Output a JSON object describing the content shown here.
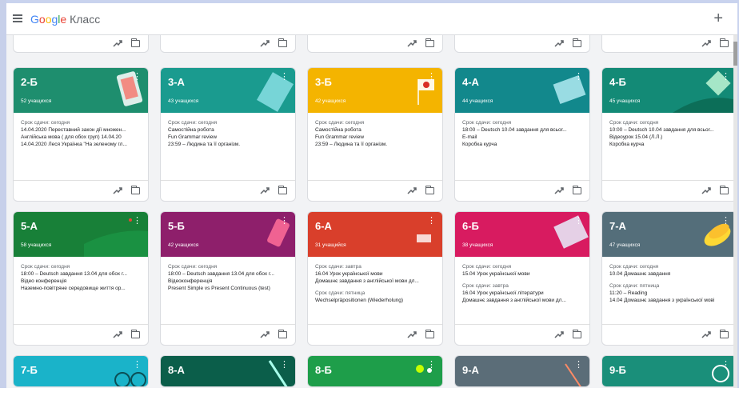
{
  "app": {
    "brand": "Google Класс"
  },
  "icons": {
    "menu": "hamburger-icon",
    "add": "plus-icon",
    "trend": "trending-up-icon",
    "folder": "folder-icon",
    "more": "more-vert-icon"
  },
  "cards": [
    {
      "name": "2-Б",
      "count": "52 учащихся",
      "color": "#1e8e6e",
      "due": "Срок сдачи: сегодня",
      "lines": [
        "14.04.2020 Переставний закон дії множен...",
        "Англійська мова ( для обох груп) 14.04.20",
        "14.04.2020 Леся Українка \"На зеленому гл..."
      ],
      "due2": "",
      "lines2": []
    },
    {
      "name": "3-А",
      "count": "43 учащихся",
      "color": "#1a9b8f",
      "due": "Срок сдачи: сегодня",
      "lines": [
        "Самостійна робота",
        "Fun Grammar review",
        "23:59 – Людина та її організм."
      ],
      "due2": "",
      "lines2": []
    },
    {
      "name": "3-Б",
      "count": "42 учащихся",
      "color": "#f4b400",
      "due": "Срок сдачи: сегодня",
      "lines": [
        "Самостійна робота",
        "Fun Grammar review",
        "23:59 – Людина та її організм."
      ],
      "due2": "",
      "lines2": []
    },
    {
      "name": "4-А",
      "count": "44 учащихся",
      "color": "#12888c",
      "due": "Срок сдачи: сегодня",
      "lines": [
        "18:00 – Deutsch 10.04 завдання для всьог...",
        "E-mail",
        "Коробка курча"
      ],
      "due2": "",
      "lines2": []
    },
    {
      "name": "4-Б",
      "count": "45 учащихся",
      "color": "#138a76",
      "due": "Срок сдачи: сегодня",
      "lines": [
        "10:00 – Deutsch 10.04 завдання для всьог...",
        "Відеоурок 15.04 (Л.Л.)",
        "Коробка курча"
      ],
      "due2": "",
      "lines2": []
    },
    {
      "name": "5-А",
      "count": "58 учащихся",
      "color": "#188038",
      "due": "Срок сдачи: сегодня",
      "lines": [
        "18:00 – Deutsch завдання 13.04 для обох г...",
        "Відео конференція",
        "Наземно-повітряне середовище життя ор..."
      ],
      "due2": "",
      "lines2": []
    },
    {
      "name": "5-Б",
      "count": "42 учащихся",
      "color": "#8e1f6b",
      "due": "Срок сдачи: сегодня",
      "lines": [
        "18:00 – Deutsch завдання 13.04 для обох г...",
        "Відеоконференція",
        "Present Simple vs Present Continuous (test)"
      ],
      "due2": "",
      "lines2": []
    },
    {
      "name": "6-А",
      "count": "31 учащийся",
      "color": "#d93f2b",
      "due": "Срок сдачи: завтра",
      "lines": [
        "16.04 Урок української мови",
        "Домашнє завдання з англійської мови дл..."
      ],
      "due2": "Срок сдачи: пятница",
      "lines2": [
        "Wechselpräpositionen (Wiederholung)"
      ]
    },
    {
      "name": "6-Б",
      "count": "38 учащихся",
      "color": "#d81b60",
      "due": "Срок сдачи: сегодня",
      "lines": [
        "15.04 Урок української мови"
      ],
      "due2": "Срок сдачи: завтра",
      "lines2": [
        "16.04 Урок української літератури",
        "Домашнє завдання з англійської мови дл..."
      ]
    },
    {
      "name": "7-А",
      "count": "47 учащихся",
      "color": "#546e7a",
      "due": "Срок сдачи: сегодня",
      "lines": [
        "10.04 Домашнє завдання"
      ],
      "due2": "Срок сдачи: пятница",
      "lines2": [
        "11:20 – Reading",
        "14.04 Домашнє завдання з української мові"
      ]
    },
    {
      "name": "7-Б",
      "count": "",
      "color": "#1ab3c9"
    },
    {
      "name": "8-А",
      "count": "",
      "color": "#0b5e4a"
    },
    {
      "name": "8-Б",
      "count": "",
      "color": "#1e9e4a"
    },
    {
      "name": "9-А",
      "count": "",
      "color": "#5b6d78"
    },
    {
      "name": "9-Б",
      "count": "",
      "color": "#1a8f7a"
    }
  ]
}
